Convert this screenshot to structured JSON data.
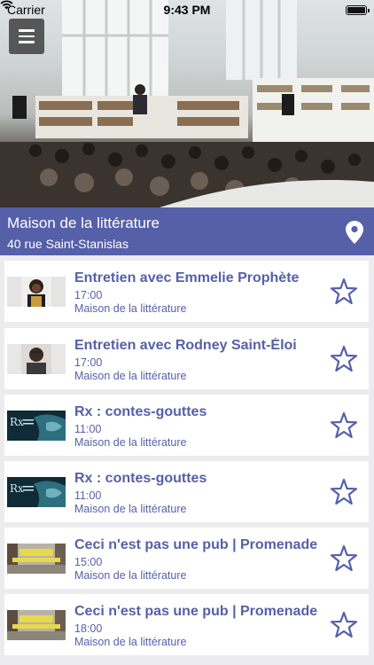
{
  "status_bar": {
    "carrier": "Carrier",
    "time": "9:43 PM"
  },
  "venue": {
    "name": "Maison de la littérature",
    "address": "40 rue Saint-Stanislas"
  },
  "colors": {
    "accent": "#5660a8"
  },
  "events": [
    {
      "title": "Entretien avec Emmelie Prophète",
      "time": "17:00",
      "venue": "Maison de la littérature",
      "thumb": "portrait-woman"
    },
    {
      "title": "Entretien avec Rodney Saint-Éloi",
      "time": "17:00",
      "venue": "Maison de la littérature",
      "thumb": "portrait-man"
    },
    {
      "title": "Rx : contes-gouttes",
      "time": "11:00",
      "venue": "Maison de la littérature",
      "thumb": "poster-rx"
    },
    {
      "title": "Rx : contes-gouttes",
      "time": "11:00",
      "venue": "Maison de la littérature",
      "thumb": "poster-rx"
    },
    {
      "title": "Ceci n'est pas une pub | Promenade",
      "time": "15:00",
      "venue": "Maison de la littérature",
      "thumb": "street-photo"
    },
    {
      "title": "Ceci n'est pas une pub | Promenade",
      "time": "18:00",
      "venue": "Maison de la littérature",
      "thumb": "street-photo"
    }
  ]
}
